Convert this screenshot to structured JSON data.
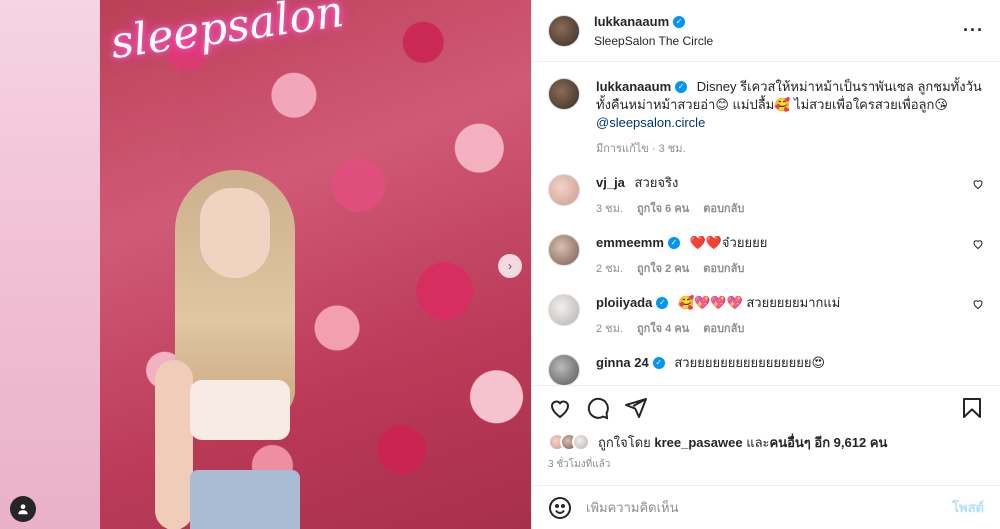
{
  "photo": {
    "neon_text": "sleepsalon",
    "next_icon": "chevron-right-icon",
    "tag_icon": "user-tag-icon"
  },
  "header": {
    "username": "lukkanaaum",
    "location": "SleepSalon The Circle",
    "more_icon": "more-options-icon",
    "more_label": "···"
  },
  "caption": {
    "username": "lukkanaaum",
    "text": "Disney รีเควสให้หม่าหม้าเป็นราพันเซล ลูกชมทั้งวันทั้งคืนหม่าหม้าสวยอ่า😊 แม่ปลื้ม🥰 ไม่สวยเพื่อใครสวยเพื่อลูก😘",
    "mention": "@sleepsalon.circle",
    "meta": "มีการแก้ไข · 3 ชม."
  },
  "comments": [
    {
      "username": "vj_ja",
      "verified": false,
      "text": "สวยจริง",
      "time": "3 ชม.",
      "likes": "ถูกใจ 6 คน",
      "reply": "ตอบกลับ"
    },
    {
      "username": "emmeemm",
      "verified": true,
      "text": "❤️❤️จ๋วยยยย",
      "time": "2 ชม.",
      "likes": "ถูกใจ 2 คน",
      "reply": "ตอบกลับ"
    },
    {
      "username": "ploiiyada",
      "verified": true,
      "text": "🥰💖💖💖 สวยยยยยมากแม่",
      "time": "2 ชม.",
      "likes": "ถูกใจ 4 คน",
      "reply": "ตอบกลับ"
    },
    {
      "username": "ginna 24",
      "verified": true,
      "text": "สวยยยยยยยยยยยยยยยย😍",
      "time": "",
      "likes": "",
      "reply": ""
    }
  ],
  "likes": {
    "prefix": "ถูกใจโดย",
    "user": "kree_pasawee",
    "middle": "และ",
    "others": "คนอื่นๆ อีก 9,612 คน"
  },
  "time_ago": "3 ชั่วโมงที่แล้ว",
  "add_comment": {
    "placeholder": "เพิ่มความคิดเห็น",
    "post_label": "โพสต์"
  },
  "colors": {
    "accent": "#0095f6",
    "link": "#00376b",
    "muted": "#8e8e8e",
    "post_disabled": "#b2dffc"
  }
}
